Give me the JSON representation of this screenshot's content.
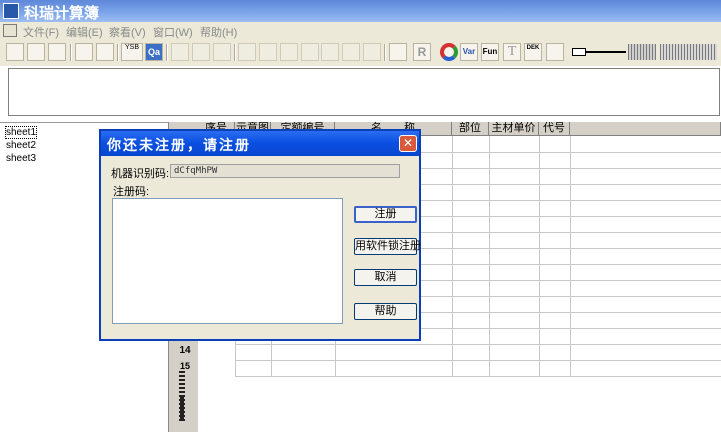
{
  "window": {
    "title": "科瑞计算簿",
    "app_icon": "kery-app-icon"
  },
  "menu": [
    {
      "label": "文件(F)"
    },
    {
      "label": "编辑(E)"
    },
    {
      "label": "察看(V)"
    },
    {
      "label": "窗口(W)"
    },
    {
      "label": "帮助(H)"
    }
  ],
  "toolbar": {
    "ysb_label": "YSB",
    "qa_label": "Qa",
    "var_label": "Var",
    "fun_label": "Fun",
    "t_label": "T",
    "dek_label": "DEK",
    "r_label": "R"
  },
  "sheets": [
    "sheet1",
    "sheet2",
    "sheet3"
  ],
  "grid": {
    "headers": [
      "序号",
      "示意图",
      "定额编号",
      "名　　称",
      "部位",
      "主材单价",
      "代号"
    ],
    "visible_row_numbers": [
      "14",
      "15"
    ]
  },
  "dialog": {
    "title": "你还未注册，请注册",
    "machine_code_label": "机器识别码:",
    "machine_code_value": "dCfqMhPW",
    "reg_code_label": "注册码:",
    "reg_code_value": "",
    "buttons": {
      "register": "注册",
      "dongle_register": "用软件锁注册",
      "cancel": "取消",
      "help": "帮助"
    }
  },
  "colors": {
    "dialog_title": "#0a4ee0",
    "window_title": "#7aa4ea",
    "chrome": "#ece9d8"
  }
}
